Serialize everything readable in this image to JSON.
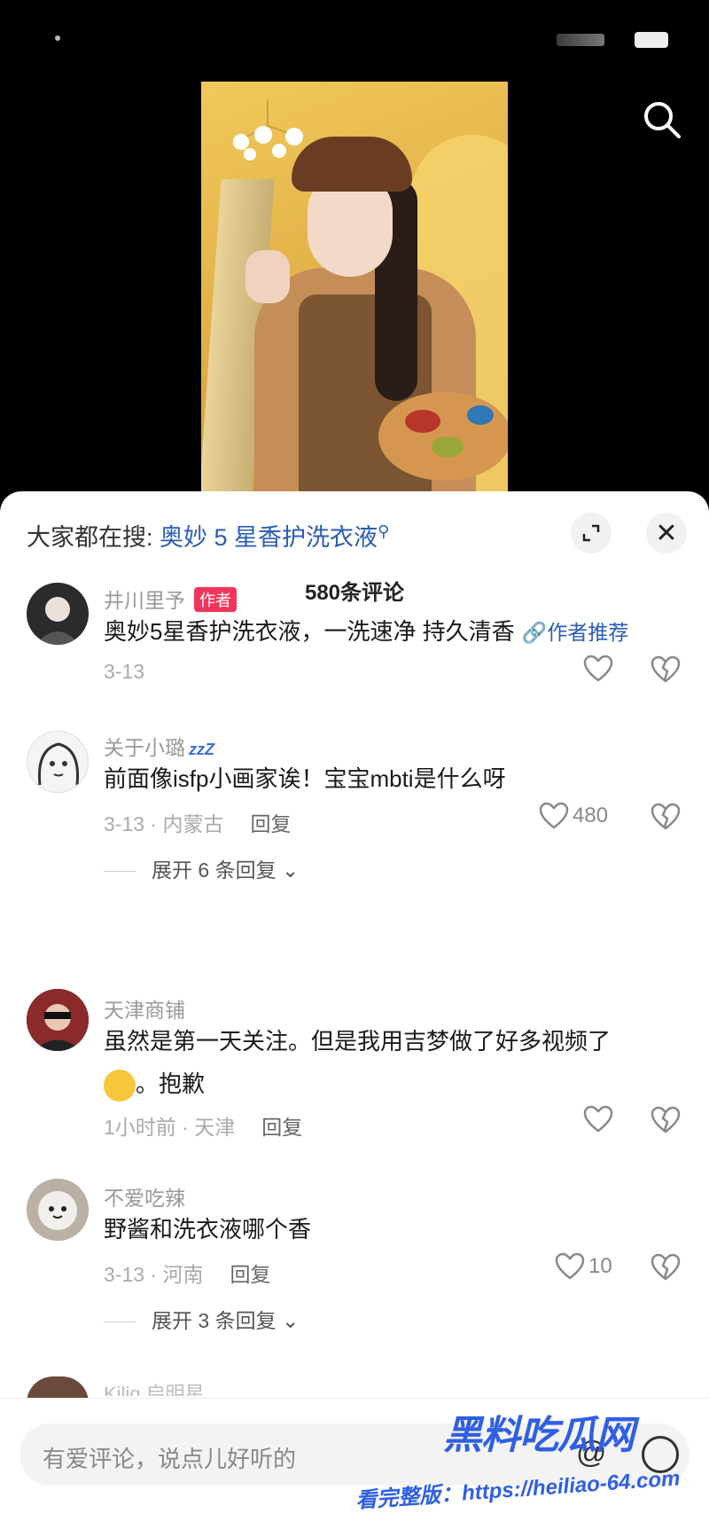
{
  "hot_search": {
    "prefix": "大家都在搜:",
    "keyword": "奥妙 5 星香护洗衣液"
  },
  "comments_header": "580条评论",
  "comments": [
    {
      "user": "井川里予",
      "tag": "作者",
      "text": "奥妙5星香护洗衣液，一洗速净 持久清香",
      "link": "作者推荐",
      "meta": "3-13",
      "reply": "",
      "likes": ""
    },
    {
      "user": "关于小璐",
      "user_suffix": "zzZ",
      "text": "前面像isfp小画家诶！宝宝mbti是什么呀",
      "meta": "3-13 · 内蒙古",
      "reply": "回复",
      "likes": "480",
      "expand": "展开 6 条回复"
    },
    {
      "user": "天津商铺",
      "text": "虽然是第一天关注。但是我用吉梦做了好多视频了",
      "text2": "。抱歉",
      "meta": "1小时前 · 天津",
      "reply": "回复",
      "likes": ""
    },
    {
      "user": "不爱吃辣",
      "text": "野酱和洗衣液哪个香",
      "meta": "3-13 · 河南",
      "reply": "回复",
      "likes": "10",
      "expand": "展开 3 条回复"
    }
  ],
  "peek_user": "Kilig 启明星",
  "input": {
    "placeholder": "有爱评论，说点儿好听的"
  },
  "watermark": {
    "title": "黑料吃瓜网",
    "url": "看完整版：https://heiliao-64.com"
  },
  "colors": {
    "link_blue": "#2a5bb8",
    "author_tag": "#f2355a",
    "watermark_blue": "#2f5fe3"
  }
}
